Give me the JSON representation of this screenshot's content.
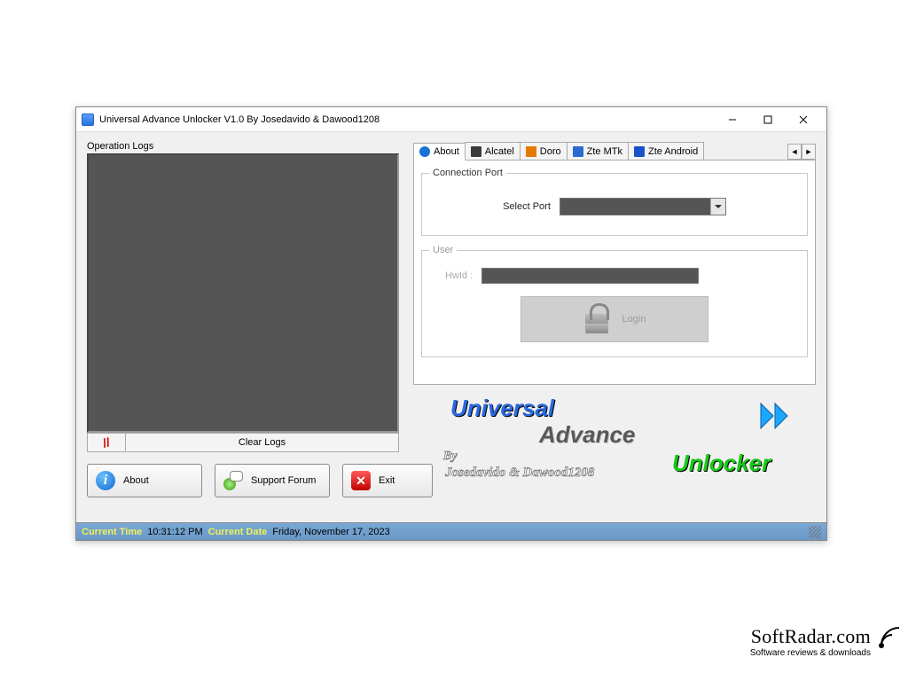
{
  "window": {
    "title": "Universal Advance Unlocker V1.0 By Josedavido & Dawood1208"
  },
  "left": {
    "logs_label": "Operation Logs",
    "clear_button": "Clear Logs"
  },
  "buttons": {
    "about": "About",
    "forum": "Support Forum",
    "exit": "Exit"
  },
  "tabs": [
    {
      "id": "about",
      "label": "About",
      "active": true
    },
    {
      "id": "alcatel",
      "label": "Alcatel",
      "active": false
    },
    {
      "id": "doro",
      "label": "Doro",
      "active": false
    },
    {
      "id": "ztemtk",
      "label": "Zte MTk",
      "active": false
    },
    {
      "id": "zteandroid",
      "label": "Zte Android",
      "active": false
    }
  ],
  "panel": {
    "connection_legend": "Connection Port",
    "select_port": "Select Port",
    "user_legend": "User",
    "hwid": "HwId   :",
    "login": "Login"
  },
  "brand": {
    "t1": "Universal",
    "t2": "Advance",
    "t3": "Unlocker",
    "by": "By",
    "authors": "Josedavido & Dawood1208"
  },
  "status": {
    "time_label": "Current Time",
    "time": "10:31:12 PM",
    "date_label": "Current Date",
    "date": "Friday, November 17, 2023"
  },
  "watermark": {
    "site": "SoftRadar.com",
    "tagline": "Software reviews & downloads"
  }
}
